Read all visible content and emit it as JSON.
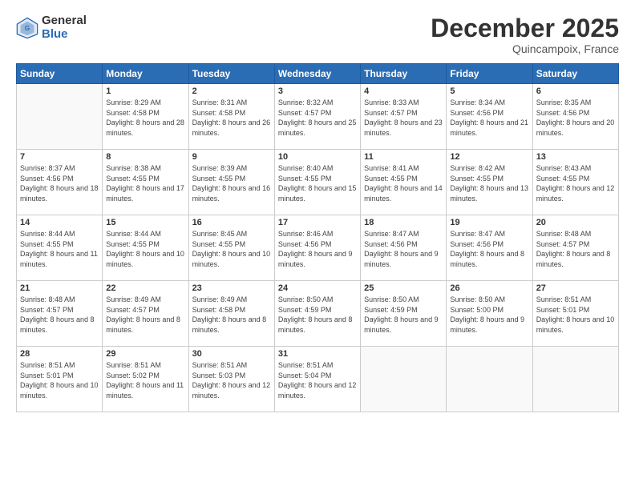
{
  "logo": {
    "general": "General",
    "blue": "Blue"
  },
  "header": {
    "month": "December 2025",
    "location": "Quincampoix, France"
  },
  "weekdays": [
    "Sunday",
    "Monday",
    "Tuesday",
    "Wednesday",
    "Thursday",
    "Friday",
    "Saturday"
  ],
  "weeks": [
    [
      {
        "day": "",
        "sunrise": "",
        "sunset": "",
        "daylight": ""
      },
      {
        "day": "1",
        "sunrise": "8:29 AM",
        "sunset": "4:58 PM",
        "daylight": "8 hours and 28 minutes."
      },
      {
        "day": "2",
        "sunrise": "8:31 AM",
        "sunset": "4:58 PM",
        "daylight": "8 hours and 26 minutes."
      },
      {
        "day": "3",
        "sunrise": "8:32 AM",
        "sunset": "4:57 PM",
        "daylight": "8 hours and 25 minutes."
      },
      {
        "day": "4",
        "sunrise": "8:33 AM",
        "sunset": "4:57 PM",
        "daylight": "8 hours and 23 minutes."
      },
      {
        "day": "5",
        "sunrise": "8:34 AM",
        "sunset": "4:56 PM",
        "daylight": "8 hours and 21 minutes."
      },
      {
        "day": "6",
        "sunrise": "8:35 AM",
        "sunset": "4:56 PM",
        "daylight": "8 hours and 20 minutes."
      }
    ],
    [
      {
        "day": "7",
        "sunrise": "8:37 AM",
        "sunset": "4:56 PM",
        "daylight": "8 hours and 18 minutes."
      },
      {
        "day": "8",
        "sunrise": "8:38 AM",
        "sunset": "4:55 PM",
        "daylight": "8 hours and 17 minutes."
      },
      {
        "day": "9",
        "sunrise": "8:39 AM",
        "sunset": "4:55 PM",
        "daylight": "8 hours and 16 minutes."
      },
      {
        "day": "10",
        "sunrise": "8:40 AM",
        "sunset": "4:55 PM",
        "daylight": "8 hours and 15 minutes."
      },
      {
        "day": "11",
        "sunrise": "8:41 AM",
        "sunset": "4:55 PM",
        "daylight": "8 hours and 14 minutes."
      },
      {
        "day": "12",
        "sunrise": "8:42 AM",
        "sunset": "4:55 PM",
        "daylight": "8 hours and 13 minutes."
      },
      {
        "day": "13",
        "sunrise": "8:43 AM",
        "sunset": "4:55 PM",
        "daylight": "8 hours and 12 minutes."
      }
    ],
    [
      {
        "day": "14",
        "sunrise": "8:44 AM",
        "sunset": "4:55 PM",
        "daylight": "8 hours and 11 minutes."
      },
      {
        "day": "15",
        "sunrise": "8:44 AM",
        "sunset": "4:55 PM",
        "daylight": "8 hours and 10 minutes."
      },
      {
        "day": "16",
        "sunrise": "8:45 AM",
        "sunset": "4:55 PM",
        "daylight": "8 hours and 10 minutes."
      },
      {
        "day": "17",
        "sunrise": "8:46 AM",
        "sunset": "4:56 PM",
        "daylight": "8 hours and 9 minutes."
      },
      {
        "day": "18",
        "sunrise": "8:47 AM",
        "sunset": "4:56 PM",
        "daylight": "8 hours and 9 minutes."
      },
      {
        "day": "19",
        "sunrise": "8:47 AM",
        "sunset": "4:56 PM",
        "daylight": "8 hours and 8 minutes."
      },
      {
        "day": "20",
        "sunrise": "8:48 AM",
        "sunset": "4:57 PM",
        "daylight": "8 hours and 8 minutes."
      }
    ],
    [
      {
        "day": "21",
        "sunrise": "8:48 AM",
        "sunset": "4:57 PM",
        "daylight": "8 hours and 8 minutes."
      },
      {
        "day": "22",
        "sunrise": "8:49 AM",
        "sunset": "4:57 PM",
        "daylight": "8 hours and 8 minutes."
      },
      {
        "day": "23",
        "sunrise": "8:49 AM",
        "sunset": "4:58 PM",
        "daylight": "8 hours and 8 minutes."
      },
      {
        "day": "24",
        "sunrise": "8:50 AM",
        "sunset": "4:59 PM",
        "daylight": "8 hours and 8 minutes."
      },
      {
        "day": "25",
        "sunrise": "8:50 AM",
        "sunset": "4:59 PM",
        "daylight": "8 hours and 9 minutes."
      },
      {
        "day": "26",
        "sunrise": "8:50 AM",
        "sunset": "5:00 PM",
        "daylight": "8 hours and 9 minutes."
      },
      {
        "day": "27",
        "sunrise": "8:51 AM",
        "sunset": "5:01 PM",
        "daylight": "8 hours and 10 minutes."
      }
    ],
    [
      {
        "day": "28",
        "sunrise": "8:51 AM",
        "sunset": "5:01 PM",
        "daylight": "8 hours and 10 minutes."
      },
      {
        "day": "29",
        "sunrise": "8:51 AM",
        "sunset": "5:02 PM",
        "daylight": "8 hours and 11 minutes."
      },
      {
        "day": "30",
        "sunrise": "8:51 AM",
        "sunset": "5:03 PM",
        "daylight": "8 hours and 12 minutes."
      },
      {
        "day": "31",
        "sunrise": "8:51 AM",
        "sunset": "5:04 PM",
        "daylight": "8 hours and 12 minutes."
      },
      {
        "day": "",
        "sunrise": "",
        "sunset": "",
        "daylight": ""
      },
      {
        "day": "",
        "sunrise": "",
        "sunset": "",
        "daylight": ""
      },
      {
        "day": "",
        "sunrise": "",
        "sunset": "",
        "daylight": ""
      }
    ]
  ]
}
